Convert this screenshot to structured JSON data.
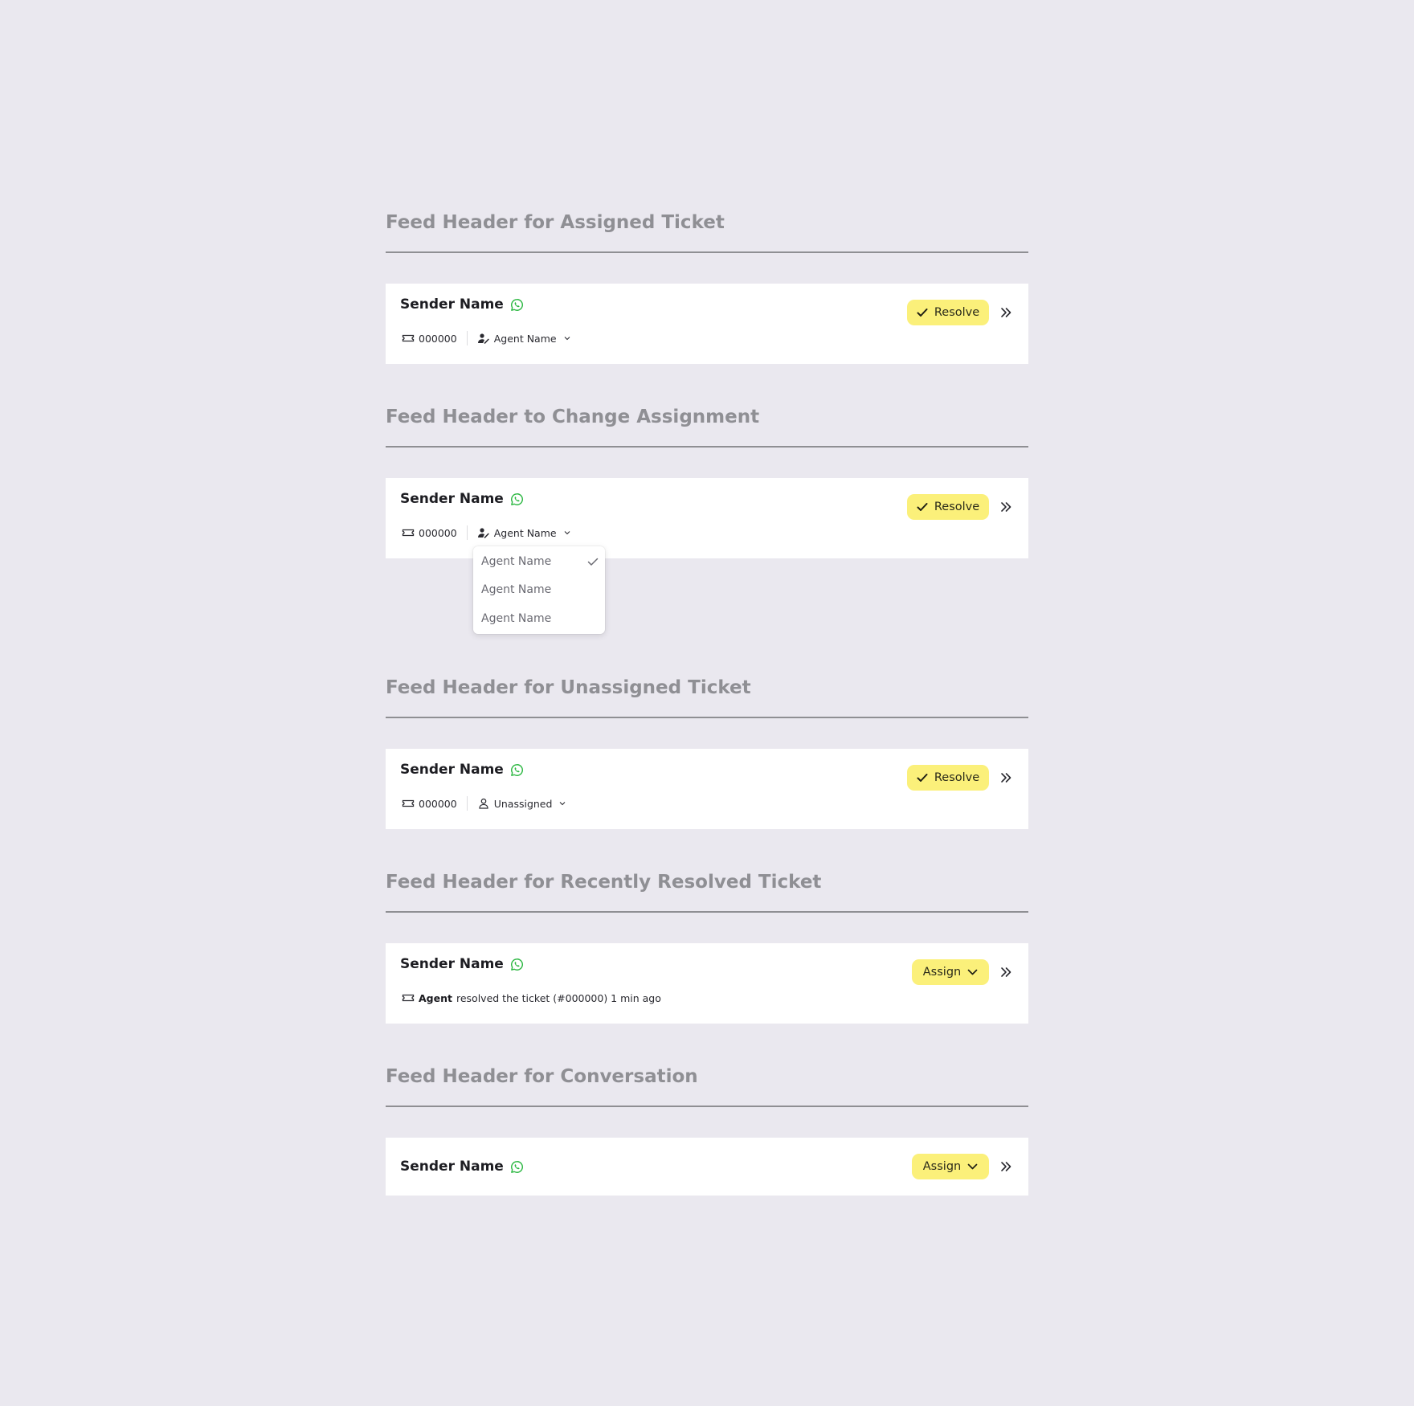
{
  "sections": [
    {
      "title": "Feed Header for Assigned Ticket",
      "sender_name": "Sender Name",
      "ticket_id": "000000",
      "assignee": "Agent Name",
      "action_label": "Resolve"
    },
    {
      "title": "Feed Header to Change Assignment",
      "sender_name": "Sender Name",
      "ticket_id": "000000",
      "assignee": "Agent Name",
      "action_label": "Resolve",
      "dropdown": {
        "options": [
          "Agent Name",
          "Agent Name",
          "Agent Name"
        ],
        "selected_index": 0
      }
    },
    {
      "title": "Feed Header for Unassigned Ticket",
      "sender_name": "Sender Name",
      "ticket_id": "000000",
      "assignee": "Unassigned",
      "action_label": "Resolve"
    },
    {
      "title": "Feed Header for Recently Resolved Ticket",
      "sender_name": "Sender Name",
      "resolved_agent": "Agent",
      "resolved_text": "resolved the ticket (#000000) 1 min ago",
      "action_label": "Assign"
    },
    {
      "title": "Feed Header for Conversation",
      "sender_name": "Sender Name",
      "action_label": "Assign"
    }
  ],
  "icons": {
    "channel": "whatsapp-icon",
    "ticket": "ticket-icon",
    "assigned": "user-assign-icon",
    "unassigned": "user-icon",
    "resolve": "check-icon",
    "assign": "chevron-down-icon",
    "expand": "double-chevron-right-icon"
  },
  "colors": {
    "background": "#eae8ef",
    "card": "#ffffff",
    "accent_yellow": "#fbf07a",
    "whatsapp_green": "#2bb741",
    "section_title": "#8f8f94"
  }
}
